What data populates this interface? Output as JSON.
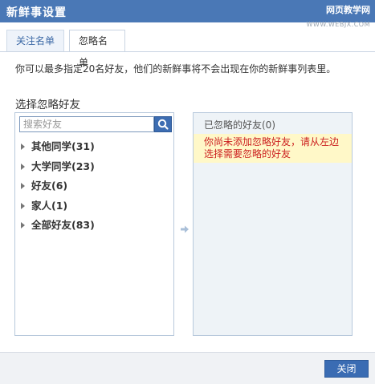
{
  "dialog": {
    "title": "新鲜事设置",
    "watermark": "网页教学网",
    "watermark_url": "WWW.WEBJX.COM"
  },
  "tabs": [
    {
      "label": "关注名单",
      "active": false
    },
    {
      "label": "忽略名单",
      "active": true
    }
  ],
  "description": "你可以最多指定20名好友，他们的新鲜事将不会出现在你的新鲜事列表里。",
  "select_section": {
    "title": "选择忽略好友",
    "search": {
      "placeholder": "搜索好友",
      "value": ""
    },
    "groups": [
      {
        "label": "其他同学(31)"
      },
      {
        "label": "大学同学(23)"
      },
      {
        "label": "好友(6)"
      },
      {
        "label": "家人(1)"
      },
      {
        "label": "全部好友(83)"
      }
    ]
  },
  "ignored_panel": {
    "header": "已忽略的好友(0)",
    "empty_message_line1": "你尚未添加忽略好友，请从左边",
    "empty_message_line2": "选择需要忽略的好友"
  },
  "footer": {
    "close_label": "关闭"
  },
  "colors": {
    "accent": "#4a78b6",
    "button": "#3a6cb3",
    "warning_text": "#cc1f1f",
    "warning_bg": "#fff8c8"
  }
}
